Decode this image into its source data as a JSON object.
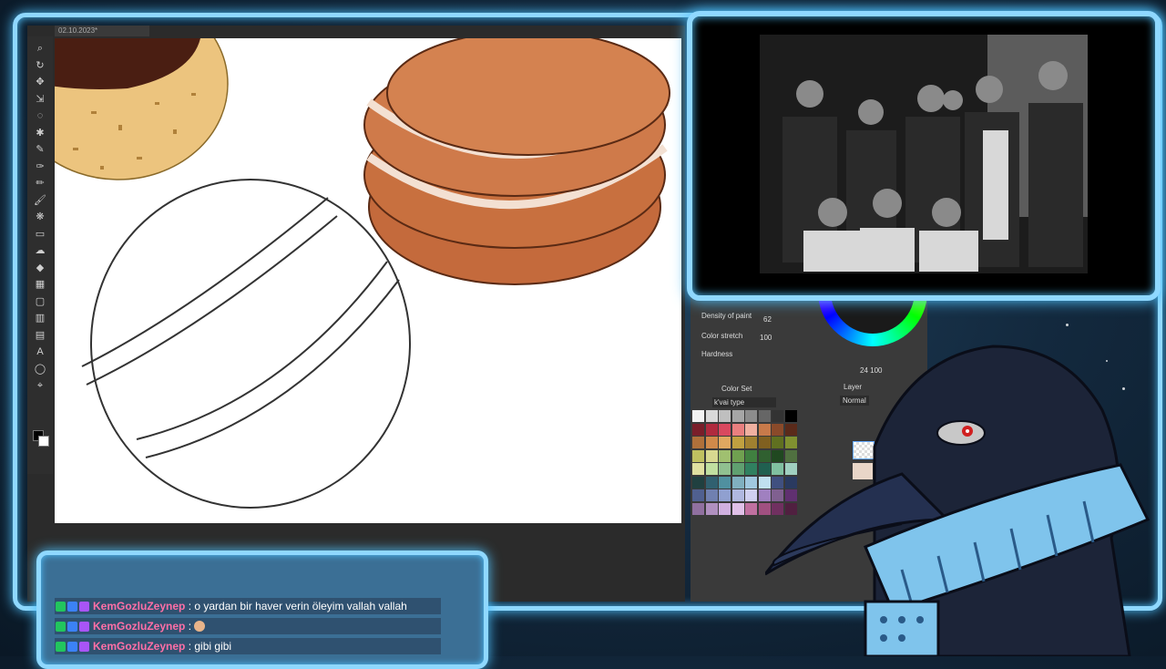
{
  "app": {
    "doc_tab": "02.10.2023*"
  },
  "tools": [
    "zoom-icon",
    "rotate-icon",
    "move-icon",
    "transform-icon",
    "lasso-icon",
    "magic-wand-icon",
    "eyedropper-icon",
    "pen-icon",
    "pencil-icon",
    "brush-icon",
    "airbrush-icon",
    "eraser-icon",
    "blend-icon",
    "fill-icon",
    "gradient-icon",
    "shape-icon",
    "frame-icon",
    "ruler-icon",
    "text-icon",
    "balloon-icon",
    "correct-line-icon"
  ],
  "tool_panel": {
    "density_label": "Density of paint",
    "density_value": "62",
    "color_stretch_label": "Color stretch",
    "color_stretch_value": "100",
    "hardness_label": "Hardness",
    "color_set_title": "Color Set",
    "color_set_name": "k'vai type",
    "layer_title": "Layer",
    "blend_mode": "Normal",
    "opacity_readout": "24  100"
  },
  "colors": {
    "frame_glow": "#8fd8ff",
    "username": "#ff6fa6",
    "chat_bg": "#2f5170",
    "swatches": [
      "#f2f2f2",
      "#d9d9d9",
      "#bfbfbf",
      "#a6a6a6",
      "#8c8c8c",
      "#666",
      "#333",
      "#000",
      "#7a1e2a",
      "#b02a3e",
      "#d9485f",
      "#e97f7f",
      "#f0b0a0",
      "#c87a4a",
      "#8a4a2a",
      "#5a2a1a",
      "#b0703a",
      "#d08a4a",
      "#e0a860",
      "#c0a040",
      "#a08030",
      "#806020",
      "#607020",
      "#809030",
      "#c0c060",
      "#d8d890",
      "#a0c070",
      "#70a050",
      "#408040",
      "#306030",
      "#204820",
      "#507040",
      "#e0e0a0",
      "#c0e0a0",
      "#90c090",
      "#60a070",
      "#308060",
      "#206050",
      "#80c0a0",
      "#a0d0c0",
      "#204040",
      "#306070",
      "#5090a0",
      "#80b0c0",
      "#a0c8e0",
      "#c0e0f0",
      "#405080",
      "#2a3a60",
      "#506090",
      "#7080b0",
      "#90a0d0",
      "#b0b8e0",
      "#d0d0f0",
      "#a080c0",
      "#806090",
      "#603070",
      "#9070a0",
      "#b090c0",
      "#d0b0e0",
      "#e0c0e8",
      "#c070a0",
      "#a05080",
      "#703060",
      "#502040"
    ]
  },
  "chat": [
    {
      "user": "KemGozluZeynep",
      "message": "o yardan bir haver verin öleyim vallah vallah",
      "emote": false
    },
    {
      "user": "KemGozluZeynep",
      "message": "",
      "emote": true
    },
    {
      "user": "KemGozluZeynep",
      "message": "gibi gibi",
      "emote": false
    }
  ],
  "separator": ":"
}
